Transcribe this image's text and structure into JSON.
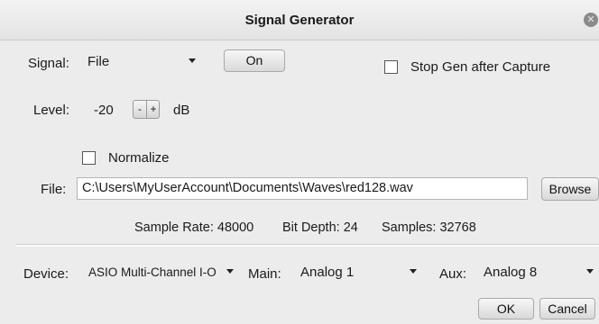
{
  "window": {
    "title": "Signal Generator"
  },
  "signal": {
    "label": "Signal:",
    "value": "File",
    "on_label": "On"
  },
  "stop_gen": {
    "label": "Stop Gen after Capture",
    "checked": false
  },
  "level": {
    "label": "Level:",
    "value": "-20",
    "minus": "-",
    "plus": "+",
    "unit": "dB"
  },
  "normalize": {
    "label": "Normalize",
    "checked": false
  },
  "file": {
    "label": "File:",
    "path": "C:\\Users\\MyUserAccount\\Documents\\Waves\\red128.wav",
    "browse_label": "Browse"
  },
  "info": {
    "sample_rate": "Sample Rate: 48000",
    "bit_depth": "Bit Depth: 24",
    "samples": "Samples: 32768"
  },
  "device": {
    "label": "Device:",
    "value": "ASIO Multi-Channel I-O"
  },
  "main": {
    "label": "Main:",
    "value": "Analog 1"
  },
  "aux": {
    "label": "Aux:",
    "value": "Analog 8"
  },
  "actions": {
    "ok": "OK",
    "cancel": "Cancel"
  },
  "icons": {
    "close": "close-icon",
    "caret": "chevron-down-icon"
  }
}
